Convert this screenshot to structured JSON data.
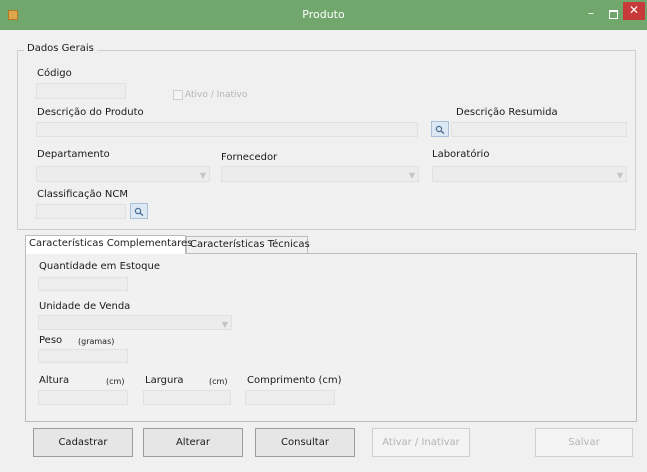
{
  "window": {
    "title": "Produto"
  },
  "group": {
    "legend": "Dados Gerais",
    "codigo_label": "Código",
    "codigo_value": "",
    "ativo_label": "Ativo / Inativo",
    "ativo_checked": false,
    "descricao_label": "Descrição do Produto",
    "descricao_value": "",
    "descricao_resumida_label": "Descrição Resumida",
    "descricao_resumida_value": "",
    "departamento_label": "Departamento",
    "departamento_value": "",
    "fornecedor_label": "Fornecedor",
    "fornecedor_value": "",
    "laboratorio_label": "Laboratório",
    "laboratorio_value": "",
    "ncm_label": "Classificação NCM",
    "ncm_value": ""
  },
  "tabs": [
    {
      "label": "Características Complementares",
      "active": true
    },
    {
      "label": "Características Técnicas",
      "active": false
    }
  ],
  "panel": {
    "estoque_label": "Quantidade em Estoque",
    "estoque_value": "",
    "unidade_label": "Unidade de Venda",
    "unidade_value": "",
    "peso_label": "Peso",
    "peso_unit": "(gramas)",
    "peso_value": "",
    "altura_label": "Altura",
    "altura_unit": "(cm)",
    "altura_value": "",
    "largura_label": "Largura",
    "largura_unit": "(cm)",
    "largura_value": "",
    "comprimento_label": "Comprimento (cm)",
    "comprimento_value": ""
  },
  "buttons": {
    "cadastrar": "Cadastrar",
    "alterar": "Alterar",
    "consultar": "Consultar",
    "ativar_inativar": "Ativar / Inativar",
    "salvar": "Salvar"
  },
  "colors": {
    "titlebar": "#71a66c",
    "close": "#c73a39",
    "window_bg": "#f0f0f0"
  }
}
